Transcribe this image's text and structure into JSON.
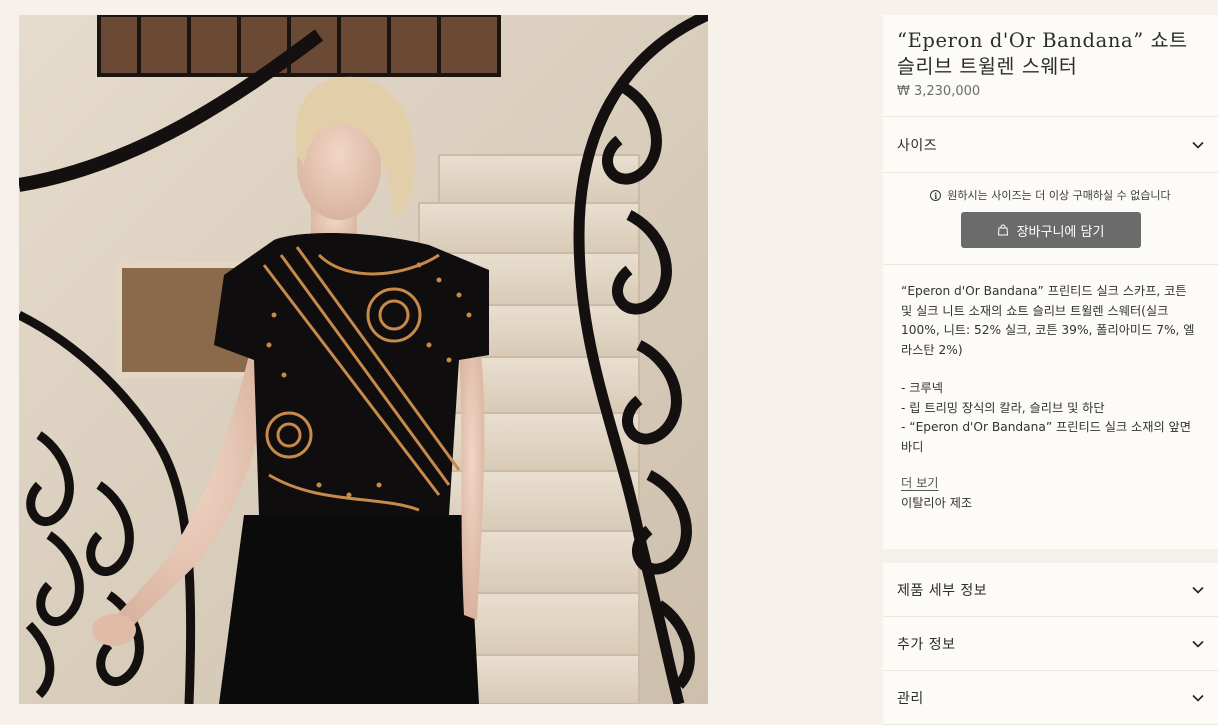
{
  "image": {
    "alt": ""
  },
  "product": {
    "title": "“Eperon d'Or Bandana” 쇼트 슬리브 트윌렌 스웨터",
    "price": "₩ 3,230,000"
  },
  "size_selector": {
    "label": "사이즈",
    "icon": "chevron-down-icon"
  },
  "availability": {
    "message": "원하시는 사이즈는 더 이상 구매하실 수 없습니다",
    "icon": "info-icon"
  },
  "cart_button": {
    "label": "장바구니에 담기",
    "icon": "shopping-bag-icon",
    "color": "#6b6b6b"
  },
  "description": {
    "text": "“Eperon d'Or Bandana” 프린티드 실크 스카프, 코튼 및 실크 니트 소재의 쇼트 슬리브 트윌렌 스웨터(실크 100%, 니트: 52% 실크, 코튼 39%, 폴리아미드 7%, 엘라스탄 2%)",
    "bullets": [
      "- 크루넥",
      "- 립 트리밍 장식의 칼라, 슬리브 및 하단",
      "- “Eperon d'Or Bandana” 프린티드 실크 소재의 앞면 바디"
    ],
    "more_link": "더 보기",
    "origin": "이탈리아 제조"
  },
  "accordions": [
    {
      "label": "제품 세부 정보"
    },
    {
      "label": "추가 정보"
    },
    {
      "label": "관리"
    }
  ],
  "colors": {
    "background": "#f6f1eb",
    "panel": "#fdfbf8",
    "button": "#6b6b6b"
  }
}
